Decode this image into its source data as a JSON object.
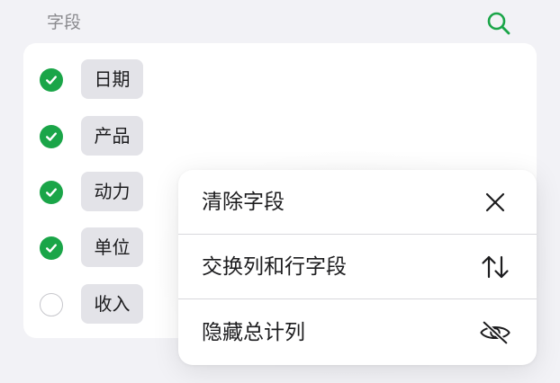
{
  "header": {
    "title": "字段"
  },
  "fields": [
    {
      "label": "日期",
      "checked": true
    },
    {
      "label": "产品",
      "checked": true
    },
    {
      "label": "动力",
      "checked": true
    },
    {
      "label": "单位",
      "checked": true
    },
    {
      "label": "收入",
      "checked": false
    }
  ],
  "menu": {
    "items": [
      {
        "label": "清除字段",
        "icon": "close-icon"
      },
      {
        "label": "交换列和行字段",
        "icon": "swap-arrows-icon"
      },
      {
        "label": "隐藏总计列",
        "icon": "eye-slash-icon"
      }
    ]
  },
  "colors": {
    "accent": "#1aa548",
    "background": "#f2f2f6",
    "chip": "#e3e3e8"
  }
}
